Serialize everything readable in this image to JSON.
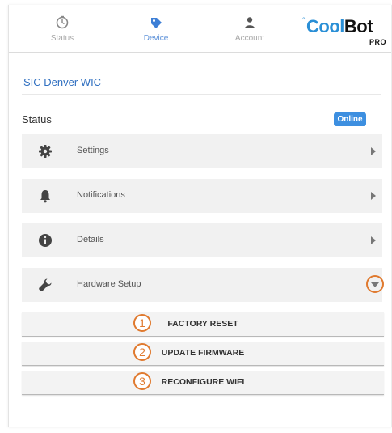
{
  "nav": {
    "tabs": [
      {
        "label": "Status",
        "icon": "clock-icon"
      },
      {
        "label": "Device",
        "icon": "tag-icon"
      },
      {
        "label": "Account",
        "icon": "person-icon"
      }
    ],
    "active_tab": "Device"
  },
  "brand": {
    "word_a": "Cool",
    "word_b": "Bot",
    "tag": "PRO",
    "color": "#2a8fd6"
  },
  "device": {
    "name": "SIC Denver WIC"
  },
  "status": {
    "label": "Status",
    "badge": "Online",
    "badge_color": "#3d8fe0"
  },
  "menu": [
    {
      "label": "Settings",
      "icon": "gear-icon"
    },
    {
      "label": "Notifications",
      "icon": "bell-icon"
    },
    {
      "label": "Details",
      "icon": "info-icon"
    },
    {
      "label": "Hardware Setup",
      "icon": "wrench-icon",
      "expanded": true
    }
  ],
  "hardware_actions": [
    {
      "number": "1",
      "label": "FACTORY RESET"
    },
    {
      "number": "2",
      "label": "UPDATE FIRMWARE"
    },
    {
      "number": "3",
      "label": "RECONFIGURE WIFI"
    }
  ],
  "accent_color": "#e07a2f"
}
